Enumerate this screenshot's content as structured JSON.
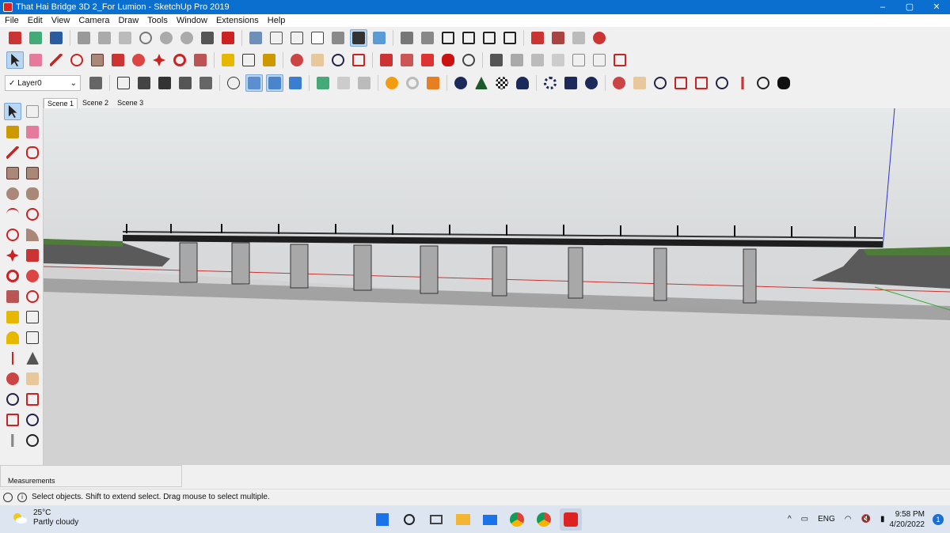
{
  "window": {
    "title": "That Hai Bridge 3D 2_For Lumion - SketchUp Pro 2019",
    "controls": [
      "–",
      "▢",
      "✕"
    ]
  },
  "menu": [
    "File",
    "Edit",
    "View",
    "Camera",
    "Draw",
    "Tools",
    "Window",
    "Extensions",
    "Help"
  ],
  "layer": {
    "label": "Layer0",
    "check": "✓"
  },
  "scenes": [
    "Scene 1",
    "Scene 2",
    "Scene 3"
  ],
  "measurements": {
    "label": "Measurements"
  },
  "status": {
    "message": "Select objects. Shift to extend select. Drag mouse to select multiple."
  },
  "weather": {
    "temp": "25°C",
    "condition": "Partly cloudy"
  },
  "tray": {
    "lang": "ENG",
    "time": "9:58 PM",
    "date": "4/20/2022",
    "notifications": "1"
  },
  "colors": {
    "titlebar": "#0b6fcf",
    "accent": "#d22"
  }
}
